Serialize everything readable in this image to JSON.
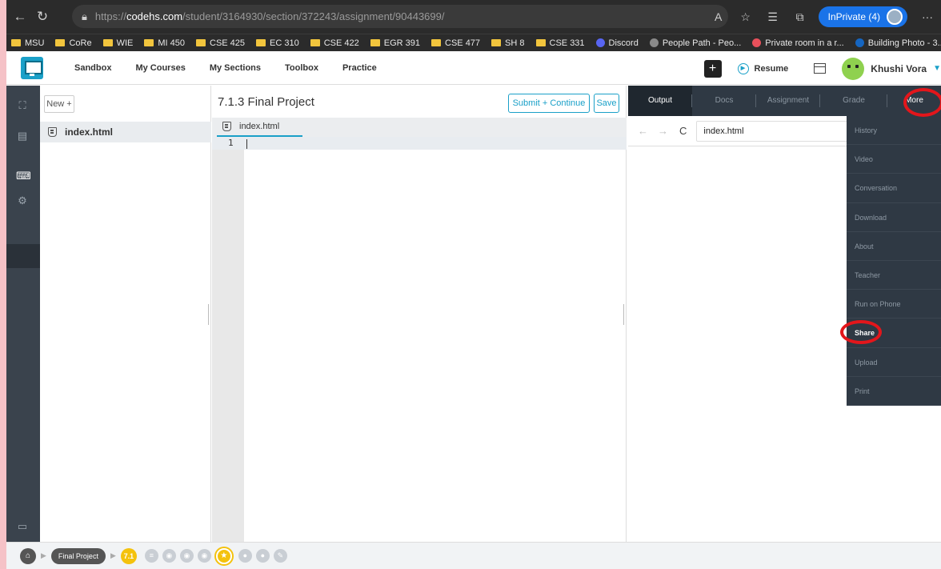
{
  "browser": {
    "url_prefix": "https://",
    "url_host": "codehs.com",
    "url_path": "/student/3164930/section/372243/assignment/90443699/",
    "inprivate_label": "InPrivate (4)",
    "more_glyph": "···"
  },
  "bookmarks": [
    {
      "label": "MSU",
      "kind": "folder"
    },
    {
      "label": "CoRe",
      "kind": "folder"
    },
    {
      "label": "WIE",
      "kind": "folder"
    },
    {
      "label": "MI 450",
      "kind": "folder"
    },
    {
      "label": "CSE 425",
      "kind": "folder"
    },
    {
      "label": "EC 310",
      "kind": "folder"
    },
    {
      "label": "CSE 422",
      "kind": "folder"
    },
    {
      "label": "EGR 391",
      "kind": "folder"
    },
    {
      "label": "CSE 477",
      "kind": "folder"
    },
    {
      "label": "SH 8",
      "kind": "folder"
    },
    {
      "label": "CSE 331",
      "kind": "folder"
    },
    {
      "label": "Discord",
      "kind": "site",
      "color": "#5865f2"
    },
    {
      "label": "People Path - Peo...",
      "kind": "site",
      "color": "#8a8a8a"
    },
    {
      "label": "Private room in a r...",
      "kind": "site",
      "color": "#e8505b"
    },
    {
      "label": "Building Photo - 3...",
      "kind": "site",
      "color": "#1565c0"
    }
  ],
  "topnav": {
    "items": [
      "Sandbox",
      "My Courses",
      "My Sections",
      "Toolbox",
      "Practice"
    ],
    "plus_label": "+",
    "resume_label": "Resume",
    "user_name": "Khushi Vora"
  },
  "files": {
    "new_label": "New +",
    "file_name": "index.html"
  },
  "editor": {
    "title": "7.1.3 Final Project",
    "submit_label": "Submit + Continue",
    "save_label": "Save",
    "tab_label": "index.html",
    "line_number": "1"
  },
  "output": {
    "tabs": [
      "Output",
      "Docs",
      "Assignment",
      "Grade",
      "More"
    ],
    "url_value": "index.html"
  },
  "more_menu": [
    "History",
    "Video",
    "Conversation",
    "Download",
    "About",
    "Teacher",
    "Run on Phone",
    "Share",
    "Upload",
    "Print"
  ],
  "bottom": {
    "project_label": "Final Project",
    "unit_label": "7.1"
  },
  "colors": {
    "accent": "#1aa0c8",
    "highlight_ring": "#e3161b",
    "unit_badge": "#f4c20d"
  }
}
